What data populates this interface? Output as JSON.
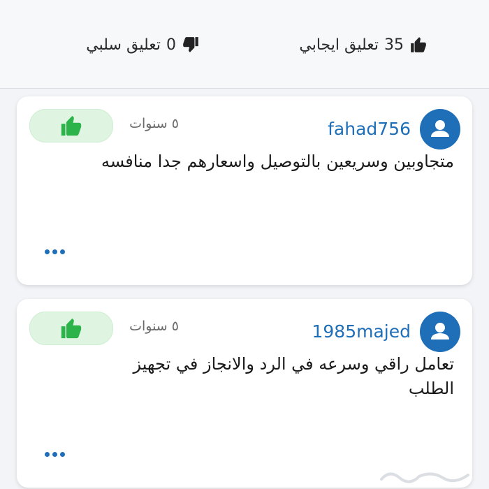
{
  "summary": {
    "positive": {
      "count": "35",
      "label": "تعليق ايجابي",
      "icon": "thumbs-up-icon"
    },
    "negative": {
      "count": "0",
      "label": "تعليق سلبي",
      "icon": "thumbs-down-icon"
    }
  },
  "reviews": [
    {
      "username": "fahad756",
      "time": "٥ سنوات",
      "text": "متجاوبين وسريعين بالتوصيل واسعارهم جدا منافسه",
      "rating_icon": "thumbs-up-icon",
      "avatar_icon": "user-icon"
    },
    {
      "username": "1985majed",
      "time": "٥ سنوات",
      "text": "تعامل راقي وسرعه في الرد والانجاز في تجهيز الطلب",
      "rating_icon": "thumbs-up-icon",
      "avatar_icon": "user-icon"
    }
  ],
  "colors": {
    "accent_blue": "#1f6fb8",
    "like_green": "#2cb34a",
    "like_bg": "#dff5e1"
  }
}
